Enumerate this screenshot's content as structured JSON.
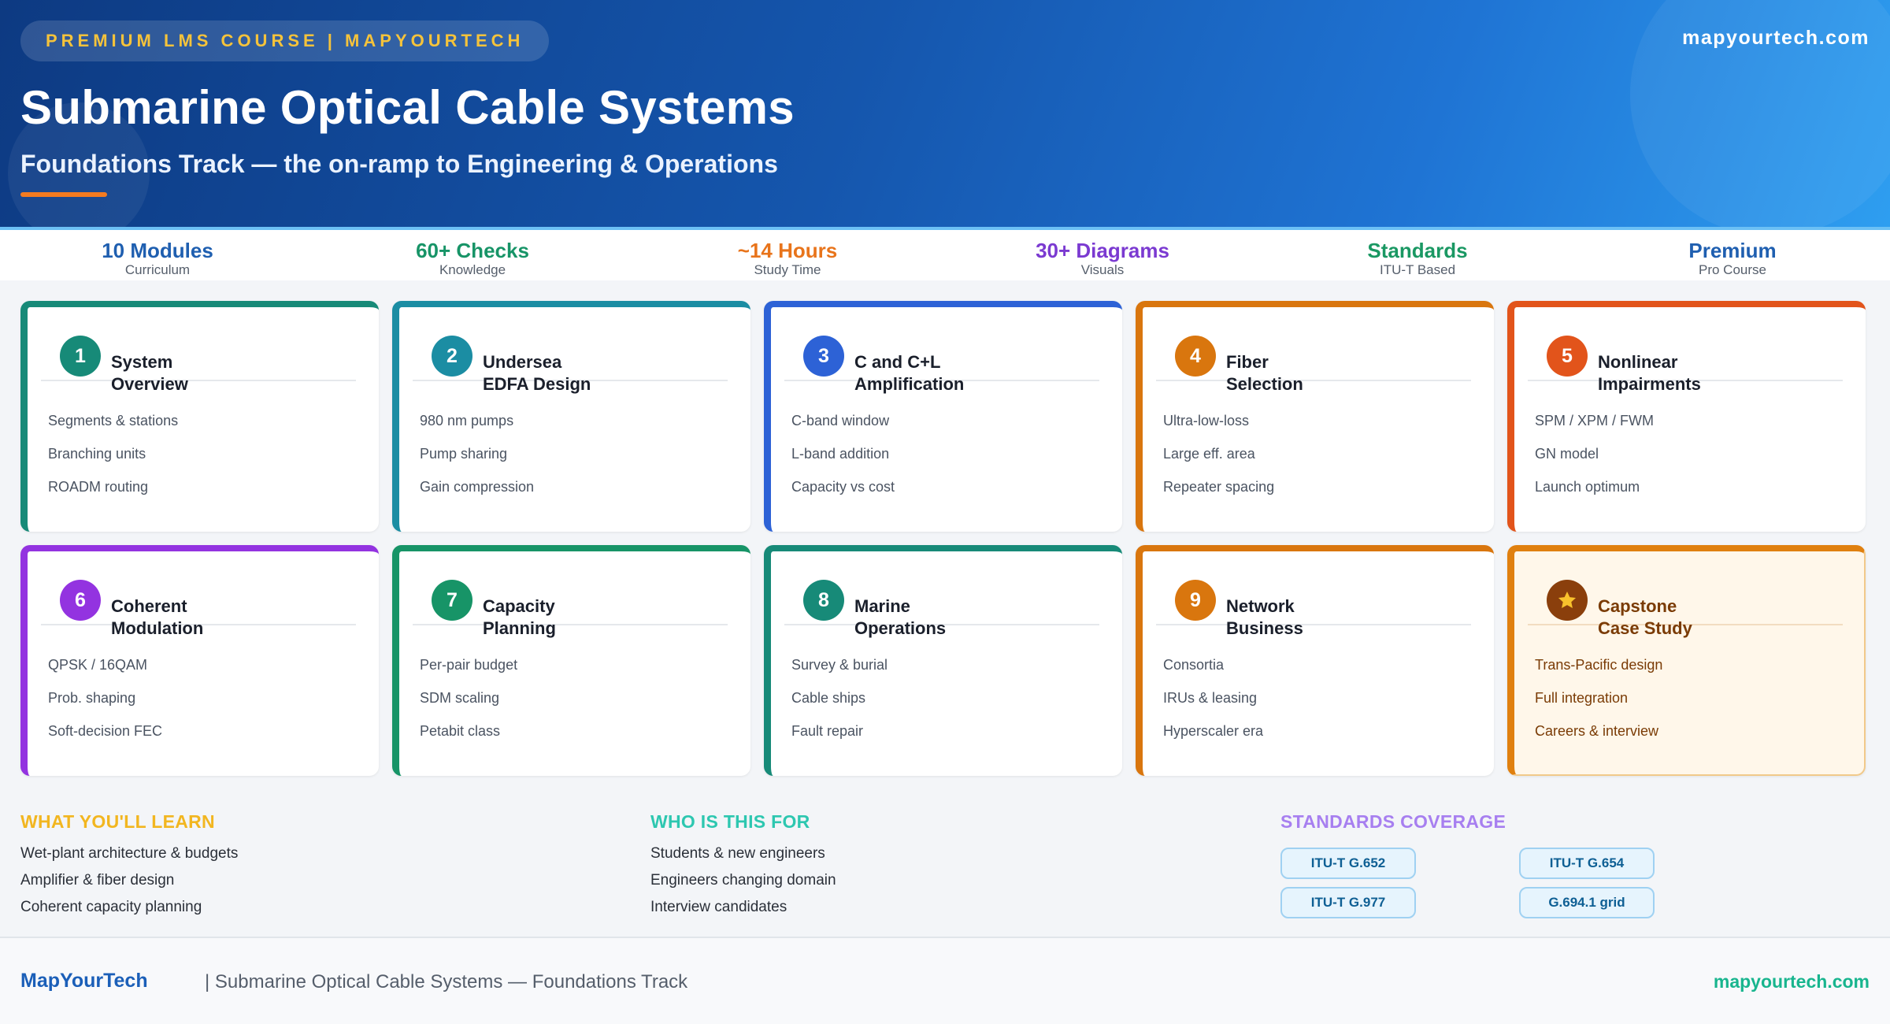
{
  "header": {
    "badge": "PREMIUM LMS COURSE | MAPYOURTECH",
    "site": "mapyourtech.com",
    "title": "Submarine Optical Cable Systems",
    "subtitle": "Foundations Track — the on-ramp to Engineering & Operations"
  },
  "stats": [
    {
      "value": "10 Modules",
      "label": "Curriculum",
      "color": "#1f5fb0"
    },
    {
      "value": "60+ Checks",
      "label": "Knowledge",
      "color": "#179467"
    },
    {
      "value": "~14 Hours",
      "label": "Study Time",
      "color": "#e8741b"
    },
    {
      "value": "30+ Diagrams",
      "label": "Visuals",
      "color": "#7b3ad1"
    },
    {
      "value": "Standards",
      "label": "ITU-T Based",
      "color": "#1a9863"
    },
    {
      "value": "Premium",
      "label": "Pro Course",
      "color": "#1f5fb0"
    }
  ],
  "modules": [
    {
      "num": "1",
      "title": [
        "System",
        "Overview"
      ],
      "color": "#178a78",
      "items": [
        "Segments & stations",
        "Branching units",
        "ROADM routing"
      ]
    },
    {
      "num": "2",
      "title": [
        "Undersea",
        "EDFA Design"
      ],
      "color": "#1b8da3",
      "items": [
        "980 nm pumps",
        "Pump sharing",
        "Gain compression"
      ]
    },
    {
      "num": "3",
      "title": [
        "C and C+L",
        "Amplification"
      ],
      "color": "#2d62d6",
      "items": [
        "C-band window",
        "L-band addition",
        "Capacity vs cost"
      ]
    },
    {
      "num": "4",
      "title": [
        "Fiber",
        "Selection"
      ],
      "color": "#d9760e",
      "items": [
        "Ultra-low-loss",
        "Large eff. area",
        "Repeater spacing"
      ]
    },
    {
      "num": "5",
      "title": [
        "Nonlinear",
        "Impairments"
      ],
      "color": "#e2541b",
      "items": [
        "SPM / XPM / FWM",
        "GN model",
        "Launch optimum"
      ]
    },
    {
      "num": "6",
      "title": [
        "Coherent",
        "Modulation"
      ],
      "color": "#9333e0",
      "items": [
        "QPSK / 16QAM",
        "Prob. shaping",
        "Soft-decision FEC"
      ]
    },
    {
      "num": "7",
      "title": [
        "Capacity",
        "Planning"
      ],
      "color": "#179467",
      "items": [
        "Per-pair budget",
        "SDM scaling",
        "Petabit class"
      ]
    },
    {
      "num": "8",
      "title": [
        "Marine",
        "Operations"
      ],
      "color": "#178a78",
      "items": [
        "Survey & burial",
        "Cable ships",
        "Fault repair"
      ]
    },
    {
      "num": "9",
      "title": [
        "Network",
        "Business"
      ],
      "color": "#d9760e",
      "items": [
        "Consortia",
        "IRUs & leasing",
        "Hyperscaler era"
      ]
    },
    {
      "num": "star-icon",
      "title": [
        "Capstone",
        "Case Study"
      ],
      "color": "#e0800f",
      "items": [
        "Trans-Pacific design",
        "Full integration",
        "Careers & interview"
      ]
    }
  ],
  "learn": {
    "heading": "WHAT YOU'LL LEARN",
    "color": "#f2b620",
    "items": [
      "Wet-plant architecture & budgets",
      "Amplifier & fiber design",
      "Coherent capacity planning"
    ]
  },
  "audience": {
    "heading": "WHO IS THIS FOR",
    "color": "#2dc7b0",
    "items": [
      "Students & new engineers",
      "Engineers changing domain",
      "Interview candidates"
    ]
  },
  "standards": {
    "heading": "STANDARDS COVERAGE",
    "color": "#a77ff0",
    "tags": [
      "ITU-T G.652",
      "ITU-T G.654",
      "ITU-T G.977",
      "G.694.1 grid"
    ]
  },
  "footer": {
    "brand": "MapYourTech",
    "text": "| Submarine Optical Cable Systems — Foundations Track",
    "site": "mapyourtech.com"
  }
}
